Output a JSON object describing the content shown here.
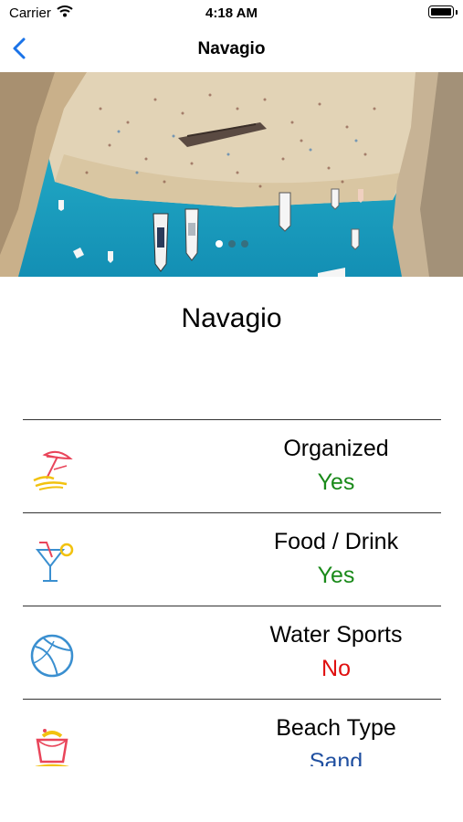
{
  "status_bar": {
    "carrier": "Carrier",
    "time": "4:18 AM",
    "icons": [
      "wifi-icon",
      "battery-icon"
    ]
  },
  "nav": {
    "back_icon": "chevron-left-icon",
    "title": "Navagio"
  },
  "hero": {
    "image": "aerial photo of beach with shipwreck and boats",
    "page_count": 3,
    "current_page": 1
  },
  "beach": {
    "name": "Navagio"
  },
  "features": [
    {
      "icon": "beach-umbrella-icon",
      "label": "Organized",
      "value": "Yes",
      "value_color": "#1a8a1a"
    },
    {
      "icon": "cocktail-icon",
      "label": "Food / Drink",
      "value": "Yes",
      "value_color": "#1a8a1a"
    },
    {
      "icon": "beach-ball-icon",
      "label": "Water Sports",
      "value": "No",
      "value_color": "#e01010"
    },
    {
      "icon": "sand-bucket-icon",
      "label": "Beach Type",
      "value": "Sand",
      "value_color": "#1f4fa0"
    }
  ],
  "colors": {
    "accent": "#1a73e8",
    "yes": "#1a8a1a",
    "no": "#e01010",
    "sand": "#1f4fa0"
  }
}
